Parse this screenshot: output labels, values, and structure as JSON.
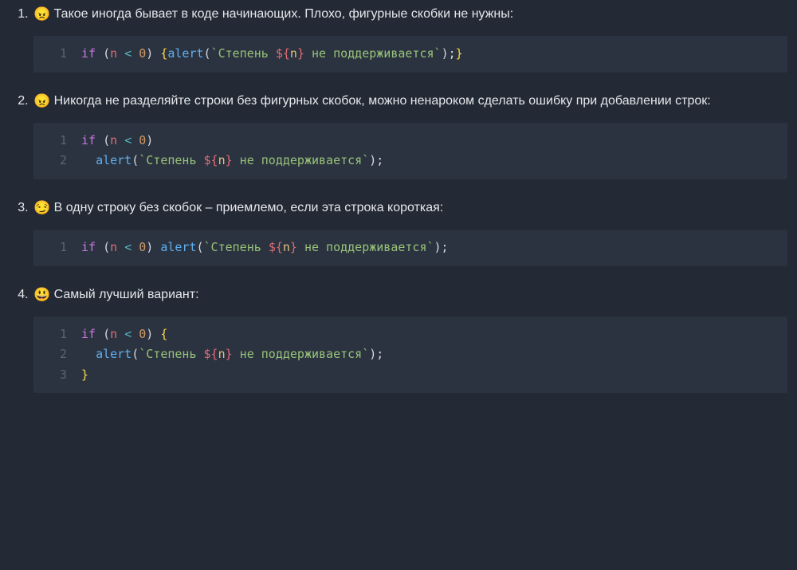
{
  "items": [
    {
      "emoji": "😠",
      "text": "Такое иногда бывает в коде начинающих. Плохо, фигурные скобки не нужны:",
      "code": [
        [
          {
            "t": "kw",
            "v": "if"
          },
          {
            "t": "sp",
            "v": " "
          },
          {
            "t": "pn",
            "v": "("
          },
          {
            "t": "id",
            "v": "n"
          },
          {
            "t": "sp",
            "v": " "
          },
          {
            "t": "op",
            "v": "<"
          },
          {
            "t": "sp",
            "v": " "
          },
          {
            "t": "num",
            "v": "0"
          },
          {
            "t": "pn",
            "v": ")"
          },
          {
            "t": "sp",
            "v": " "
          },
          {
            "t": "br",
            "v": "{"
          },
          {
            "t": "fn",
            "v": "alert"
          },
          {
            "t": "pn",
            "v": "("
          },
          {
            "t": "str",
            "v": "`Степень "
          },
          {
            "t": "int",
            "v": "${"
          },
          {
            "t": "iid",
            "v": "n"
          },
          {
            "t": "int",
            "v": "}"
          },
          {
            "t": "str",
            "v": " не поддерживается`"
          },
          {
            "t": "pn",
            "v": ");"
          },
          {
            "t": "br",
            "v": "}"
          }
        ]
      ]
    },
    {
      "emoji": "😠",
      "text": "Никогда не разделяйте строки без фигурных скобок, можно ненароком сделать ошибку при добавлении строк:",
      "code": [
        [
          {
            "t": "kw",
            "v": "if"
          },
          {
            "t": "sp",
            "v": " "
          },
          {
            "t": "pn",
            "v": "("
          },
          {
            "t": "id",
            "v": "n"
          },
          {
            "t": "sp",
            "v": " "
          },
          {
            "t": "op",
            "v": "<"
          },
          {
            "t": "sp",
            "v": " "
          },
          {
            "t": "num",
            "v": "0"
          },
          {
            "t": "pn",
            "v": ")"
          }
        ],
        [
          {
            "t": "sp",
            "v": "  "
          },
          {
            "t": "fn",
            "v": "alert"
          },
          {
            "t": "pn",
            "v": "("
          },
          {
            "t": "str",
            "v": "`Степень "
          },
          {
            "t": "int",
            "v": "${"
          },
          {
            "t": "iid",
            "v": "n"
          },
          {
            "t": "int",
            "v": "}"
          },
          {
            "t": "str",
            "v": " не поддерживается`"
          },
          {
            "t": "pn",
            "v": ");"
          }
        ]
      ]
    },
    {
      "emoji": "😏",
      "text": "В одну строку без скобок – приемлемо, если эта строка короткая:",
      "code": [
        [
          {
            "t": "kw",
            "v": "if"
          },
          {
            "t": "sp",
            "v": " "
          },
          {
            "t": "pn",
            "v": "("
          },
          {
            "t": "id",
            "v": "n"
          },
          {
            "t": "sp",
            "v": " "
          },
          {
            "t": "op",
            "v": "<"
          },
          {
            "t": "sp",
            "v": " "
          },
          {
            "t": "num",
            "v": "0"
          },
          {
            "t": "pn",
            "v": ")"
          },
          {
            "t": "sp",
            "v": " "
          },
          {
            "t": "fn",
            "v": "alert"
          },
          {
            "t": "pn",
            "v": "("
          },
          {
            "t": "str",
            "v": "`Степень "
          },
          {
            "t": "int",
            "v": "${"
          },
          {
            "t": "iid",
            "v": "n"
          },
          {
            "t": "int",
            "v": "}"
          },
          {
            "t": "str",
            "v": " не поддерживается`"
          },
          {
            "t": "pn",
            "v": ");"
          }
        ]
      ]
    },
    {
      "emoji": "😃",
      "text": "Самый лучший вариант:",
      "code": [
        [
          {
            "t": "kw",
            "v": "if"
          },
          {
            "t": "sp",
            "v": " "
          },
          {
            "t": "pn",
            "v": "("
          },
          {
            "t": "id",
            "v": "n"
          },
          {
            "t": "sp",
            "v": " "
          },
          {
            "t": "op",
            "v": "<"
          },
          {
            "t": "sp",
            "v": " "
          },
          {
            "t": "num",
            "v": "0"
          },
          {
            "t": "pn",
            "v": ")"
          },
          {
            "t": "sp",
            "v": " "
          },
          {
            "t": "br",
            "v": "{"
          }
        ],
        [
          {
            "t": "sp",
            "v": "  "
          },
          {
            "t": "fn",
            "v": "alert"
          },
          {
            "t": "pn",
            "v": "("
          },
          {
            "t": "str",
            "v": "`Степень "
          },
          {
            "t": "int",
            "v": "${"
          },
          {
            "t": "iid",
            "v": "n"
          },
          {
            "t": "int",
            "v": "}"
          },
          {
            "t": "str",
            "v": " не поддерживается`"
          },
          {
            "t": "pn",
            "v": ");"
          }
        ],
        [
          {
            "t": "br",
            "v": "}"
          }
        ]
      ]
    }
  ]
}
